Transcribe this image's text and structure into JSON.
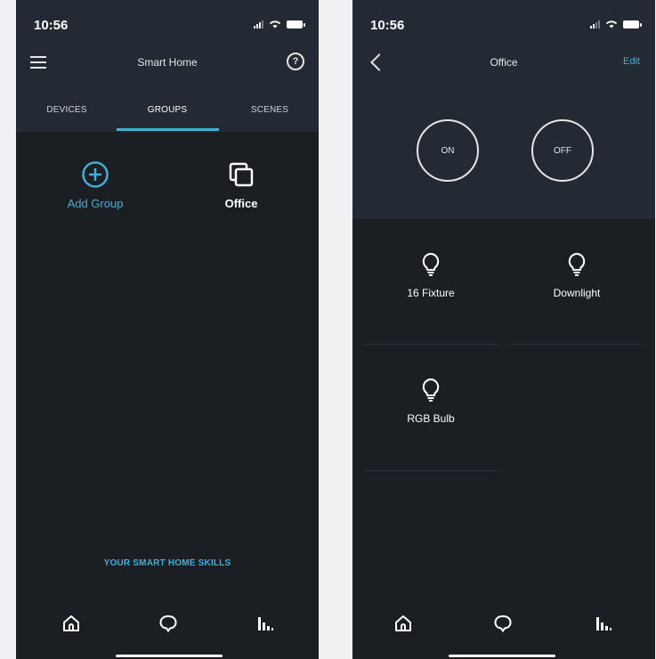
{
  "left": {
    "status": {
      "time": "10:56"
    },
    "nav": {
      "title": "Smart Home"
    },
    "tabs": [
      {
        "label": "DEVICES"
      },
      {
        "label": "GROUPS"
      },
      {
        "label": "SCENES"
      }
    ],
    "active_tab": "GROUPS",
    "tiles": [
      {
        "label": "Add Group",
        "icon": "plus-circle-icon"
      },
      {
        "label": "Office",
        "icon": "group-squares-icon"
      }
    ],
    "footer_link": "YOUR SMART HOME SKILLS",
    "bottom_nav": [
      {
        "icon": "home-icon"
      },
      {
        "icon": "chat-icon"
      },
      {
        "icon": "bars-icon"
      }
    ]
  },
  "right": {
    "status": {
      "time": "10:56"
    },
    "nav": {
      "title": "Office",
      "edit_label": "Edit"
    },
    "power": {
      "on_label": "ON",
      "off_label": "OFF"
    },
    "devices": [
      {
        "name": "16 Fixture",
        "icon": "bulb-icon"
      },
      {
        "name": "Downlight",
        "icon": "bulb-icon"
      },
      {
        "name": "RGB Bulb",
        "icon": "bulb-icon"
      }
    ],
    "bottom_nav": [
      {
        "icon": "home-icon"
      },
      {
        "icon": "chat-icon"
      },
      {
        "icon": "bars-icon"
      }
    ]
  },
  "colors": {
    "accent": "#3fb0d6",
    "background": "#1b1e23",
    "header": "#242a33",
    "page": "#f1f1f3"
  }
}
